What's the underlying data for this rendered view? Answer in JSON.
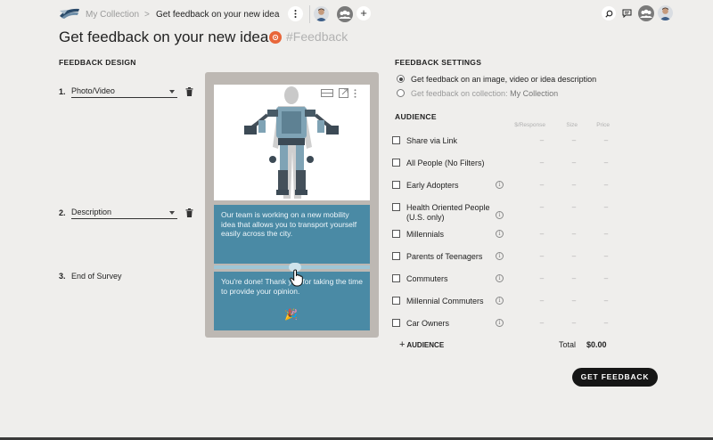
{
  "breadcrumb": {
    "parent": "My Collection",
    "separator": ">",
    "current": "Get feedback on your new idea"
  },
  "page": {
    "title": "Get feedback on your new idea",
    "tag": "#Feedback"
  },
  "design": {
    "heading": "FEEDBACK DESIGN",
    "steps": [
      {
        "num": "1.",
        "label": "Photo/Video"
      },
      {
        "num": "2.",
        "label": "Description"
      },
      {
        "num": "3.",
        "label": "End of Survey"
      }
    ]
  },
  "preview": {
    "description": "Our team is working on a new mobility idea that allows you to transport yourself easily across the city.",
    "thanks": "You're done! Thank you for taking the time to provide your opinion.",
    "party_emoji": "🎉"
  },
  "settings": {
    "heading": "FEEDBACK SETTINGS",
    "option1": "Get feedback on an image, video or idea description",
    "option2_prefix": "Get feedback on collection: ",
    "option2_name": "My Collection"
  },
  "audience": {
    "heading": "AUDIENCE",
    "columns": {
      "response": "$/Response",
      "size": "Size",
      "price": "Price"
    },
    "rows": [
      {
        "label": "Share via Link",
        "info": false
      },
      {
        "label": "All People (No Filters)",
        "info": false
      },
      {
        "label": "Early Adopters",
        "info": true
      },
      {
        "label": "Health Oriented People",
        "label2": "(U.S. only)",
        "info": true
      },
      {
        "label": "Millennials",
        "info": true
      },
      {
        "label": "Parents of Teenagers",
        "info": true
      },
      {
        "label": "Commuters",
        "info": true
      },
      {
        "label": "Millennial Commuters",
        "info": true
      },
      {
        "label": "Car Owners",
        "info": true
      }
    ],
    "dash": "–",
    "add_label": "AUDIENCE",
    "total_label": "Total",
    "total_value": "$0.00"
  },
  "actions": {
    "get_feedback": "GET FEEDBACK"
  },
  "colors": {
    "accent_card": "#4a8aa5",
    "tag": "#e8663a",
    "button": "#161616"
  }
}
